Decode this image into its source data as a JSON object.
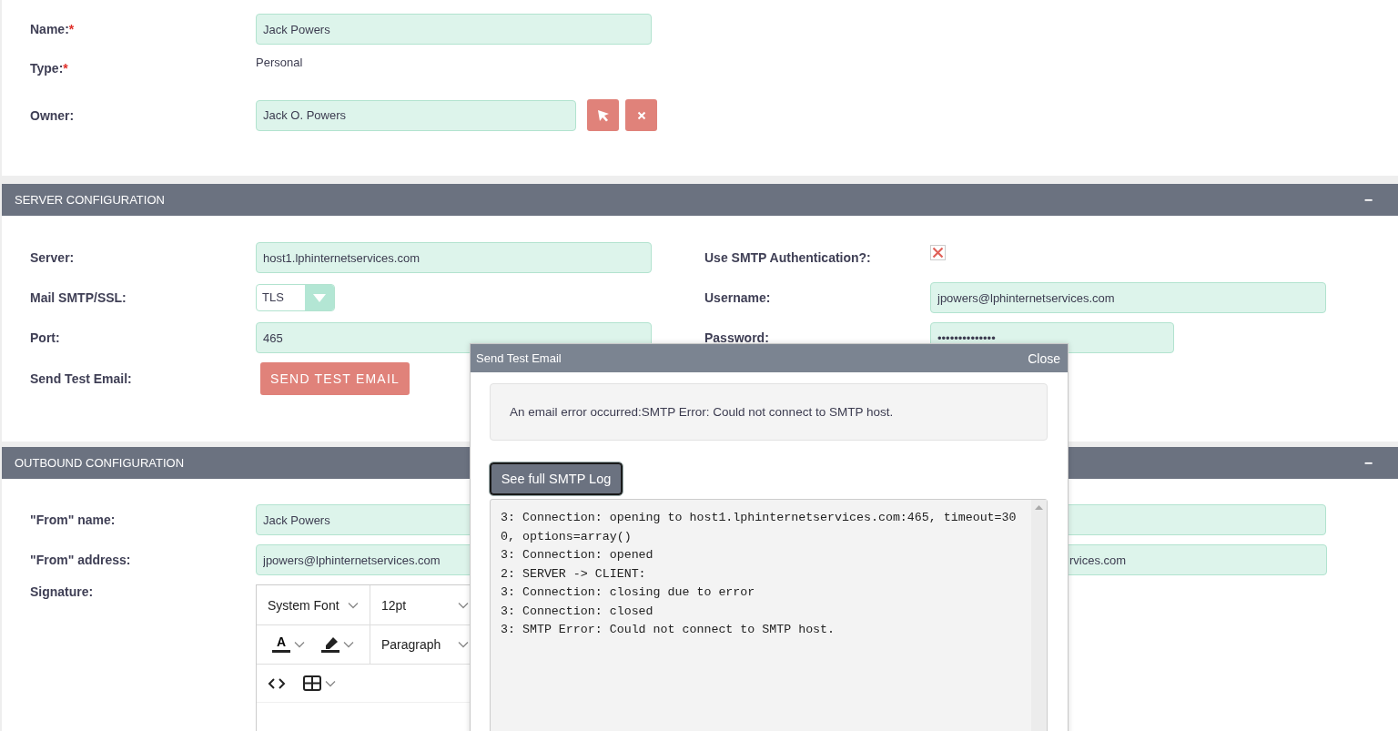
{
  "record": {
    "fields": [
      {
        "label": "Name:",
        "required_mark": "*",
        "kind": "text",
        "value": "Jack Powers"
      },
      {
        "label": "Type:",
        "required_mark": "*",
        "kind": "static",
        "value": "Personal"
      },
      {
        "label": "Owner:",
        "kind": "relate",
        "value": "Jack O. Powers"
      }
    ]
  },
  "server_configuration": {
    "title": "SERVER CONFIGURATION",
    "toggle": "−",
    "left_fields": [
      {
        "label": "Server:",
        "kind": "text",
        "value": "host1.lphinternetservices.com"
      },
      {
        "label": "Mail SMTP/SSL:",
        "kind": "select",
        "value": "TLS"
      },
      {
        "label": "Port:",
        "kind": "text",
        "value": "465"
      },
      {
        "label": "Send Test Email:",
        "kind": "button",
        "value": "SEND TEST EMAIL"
      }
    ],
    "right_fields": [
      {
        "label": "Use SMTP Authentication?:",
        "kind": "checkbox",
        "checked": true
      },
      {
        "label": "Username:",
        "kind": "text",
        "value": "jpowers@lphinternetservices.com"
      },
      {
        "label": "Password:",
        "kind": "password",
        "value": "••••••••••••••"
      }
    ]
  },
  "outbound_configuration": {
    "title": "OUTBOUND CONFIGURATION",
    "toggle": "−",
    "left_fields": [
      {
        "label": "\"From\" name:",
        "kind": "text",
        "value": "Jack Powers"
      },
      {
        "label": "\"From\" address:",
        "kind": "text",
        "value": "jpowers@lphinternetservices.com"
      },
      {
        "label": "Signature:",
        "kind": "editor",
        "font_family": "System Font",
        "font_size": "12pt",
        "text_color": "A",
        "block_format": "Paragraph"
      }
    ],
    "right_fields": [
      {
        "kind": "text"
      },
      {
        "kind": "text",
        "value": "rvices.com"
      }
    ]
  },
  "dialog": {
    "title": "Send Test Email",
    "close": "Close",
    "message": "An email error occurred:SMTP Error: Could not connect to SMTP host.",
    "log_button": "See full SMTP Log",
    "log_lines": [
      "3: Connection: opening to host1.lphinternetservices.com:465, timeout=300, options=array()",
      "3: Connection: opened",
      "2: SERVER -> CLIENT:",
      "3: Connection: closing due to error",
      "3: Connection: closed",
      "3: SMTP Error: Could not connect to SMTP host."
    ]
  }
}
